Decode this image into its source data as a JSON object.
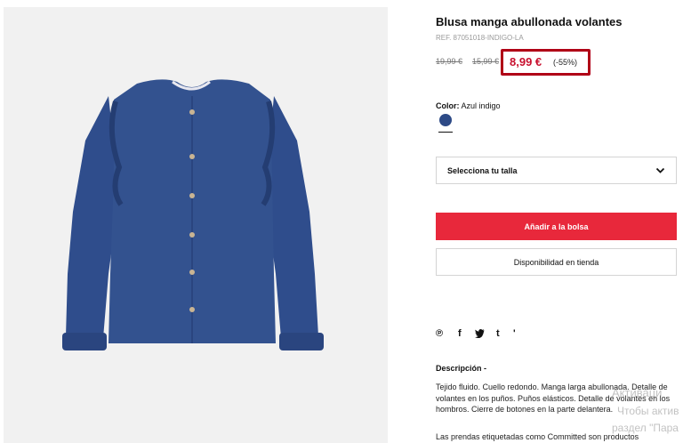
{
  "product": {
    "title": "Blusa manga abullonada volantes",
    "reference": "REF. 87051018-INDIGO-LA",
    "original_price": "19,99 €",
    "previous_price": "15,99 €",
    "current_price": "8,99 €",
    "discount": "(-55%)",
    "color_label": "Color:",
    "color_value": "Azul indigo",
    "swatch_color": "#2d4a86"
  },
  "size_select": {
    "placeholder": "Selecciona tu talla"
  },
  "buttons": {
    "add_to_bag": "Añadir a la bolsa",
    "store_availability": "Disponibilidad en tienda"
  },
  "social": [
    {
      "name": "pinterest-icon",
      "glyph": "℗"
    },
    {
      "name": "facebook-icon",
      "glyph": "f"
    },
    {
      "name": "twitter-icon",
      "glyph": "🐦"
    },
    {
      "name": "tumblr-icon",
      "glyph": "t"
    },
    {
      "name": "more-icon",
      "glyph": "'"
    }
  ],
  "description": {
    "title": "Descripción -",
    "body": "Tejido fluido. Cuello redondo. Manga larga abullonada. Detalle de volantes en los puños. Puños elásticos. Detalle de volantes en los hombros. Cierre de botones en la parte delantera.",
    "footer": "Las prendas etiquetadas como Committed son productos"
  },
  "watermark": {
    "line1": "Активаци",
    "line2": "Чтобы актив",
    "line3": "раздел \"Пара"
  },
  "colors": {
    "accent_red": "#e8283b",
    "price_red": "#c8102e",
    "highlight_border": "#b00016"
  }
}
